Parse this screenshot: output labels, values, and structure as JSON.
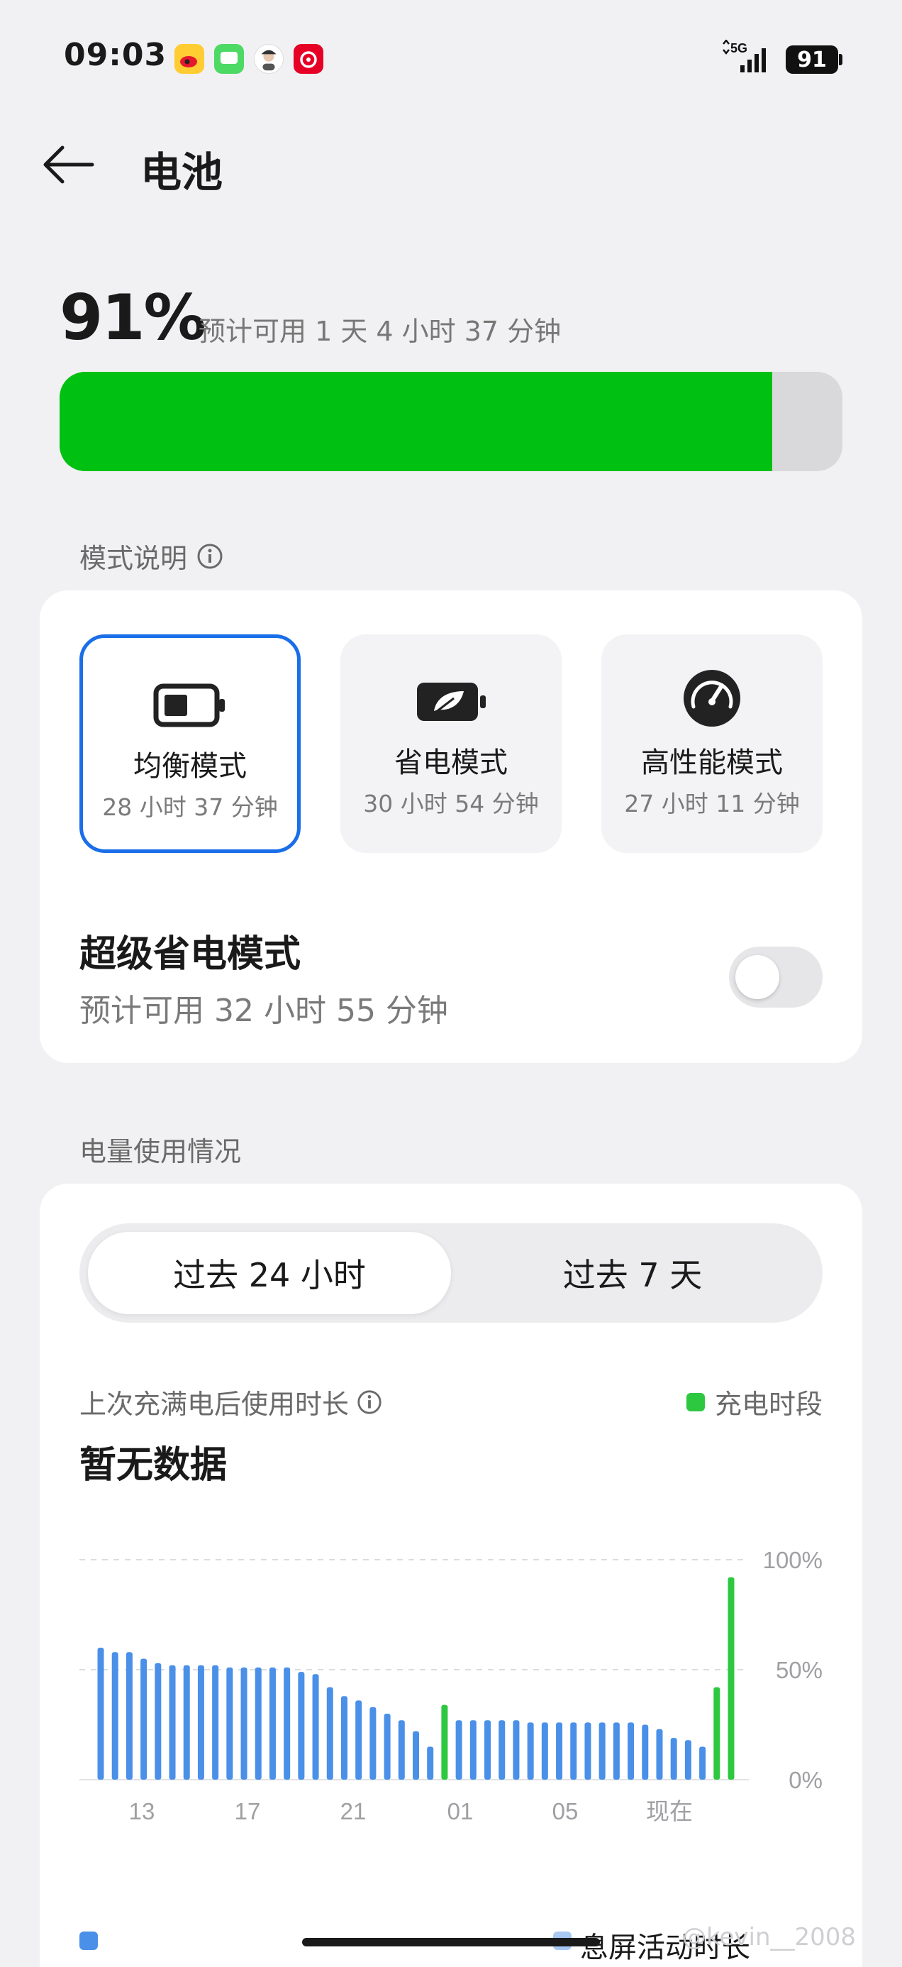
{
  "status_bar": {
    "time": "09:03",
    "network": "5G",
    "battery_level": "91",
    "app_icons": [
      "weibo-icon",
      "messages-icon",
      "avatar-icon",
      "netease-music-icon"
    ]
  },
  "header": {
    "title": "电池",
    "back_icon": "arrow-left-icon"
  },
  "battery": {
    "percent_label": "91%",
    "level_fraction": 0.91,
    "estimate": "预计可用 1 天 4 小时 37 分钟",
    "bar_color": "#00c112"
  },
  "mode_section": {
    "title": "模式说明",
    "info_icon": "info-icon",
    "modes": [
      {
        "name": "均衡模式",
        "time": "28 小时 37 分钟",
        "icon": "battery-icon",
        "selected": true
      },
      {
        "name": "省电模式",
        "time": "30 小时 54 分钟",
        "icon": "leaf-battery-icon",
        "selected": false
      },
      {
        "name": "高性能模式",
        "time": "27 小时 11 分钟",
        "icon": "speedometer-icon",
        "selected": false
      }
    ],
    "selected_color": "#1a6ee8"
  },
  "super_saver": {
    "title": "超级省电模式",
    "subtitle": "预计可用 32 小时 55 分钟",
    "enabled": false
  },
  "usage_section": {
    "title": "电量使用情况",
    "tabs": [
      "过去 24 小时",
      "过去 7 天"
    ],
    "active_tab": 0,
    "since_full_label": "上次充满电后使用时长",
    "charge_legend": "充电时段",
    "no_data": "暂无数据",
    "legend_screen_off": "息屏活动时长"
  },
  "chart_data": {
    "type": "bar",
    "y_ticks": [
      "100%",
      "50%",
      "0%"
    ],
    "ylim": [
      0,
      100
    ],
    "x_ticks": [
      "13",
      "17",
      "21",
      "01",
      "05",
      "现在"
    ],
    "colors": {
      "usage": "#4a90e8",
      "charging": "#2ec840"
    },
    "bars": [
      {
        "v": 60,
        "c": 0
      },
      {
        "v": 58,
        "c": 0
      },
      {
        "v": 58,
        "c": 0
      },
      {
        "v": 55,
        "c": 0
      },
      {
        "v": 53,
        "c": 0
      },
      {
        "v": 52,
        "c": 0
      },
      {
        "v": 52,
        "c": 0
      },
      {
        "v": 52,
        "c": 0
      },
      {
        "v": 52,
        "c": 0
      },
      {
        "v": 51,
        "c": 0
      },
      {
        "v": 51,
        "c": 0
      },
      {
        "v": 51,
        "c": 0
      },
      {
        "v": 51,
        "c": 0
      },
      {
        "v": 51,
        "c": 0
      },
      {
        "v": 49,
        "c": 0
      },
      {
        "v": 48,
        "c": 0
      },
      {
        "v": 42,
        "c": 0
      },
      {
        "v": 38,
        "c": 0
      },
      {
        "v": 36,
        "c": 0
      },
      {
        "v": 33,
        "c": 0
      },
      {
        "v": 30,
        "c": 0
      },
      {
        "v": 27,
        "c": 0
      },
      {
        "v": 22,
        "c": 0
      },
      {
        "v": 15,
        "c": 0
      },
      {
        "v": 34,
        "c": 1
      },
      {
        "v": 27,
        "c": 0
      },
      {
        "v": 27,
        "c": 0
      },
      {
        "v": 27,
        "c": 0
      },
      {
        "v": 27,
        "c": 0
      },
      {
        "v": 27,
        "c": 0
      },
      {
        "v": 26,
        "c": 0
      },
      {
        "v": 26,
        "c": 0
      },
      {
        "v": 26,
        "c": 0
      },
      {
        "v": 26,
        "c": 0
      },
      {
        "v": 26,
        "c": 0
      },
      {
        "v": 26,
        "c": 0
      },
      {
        "v": 26,
        "c": 0
      },
      {
        "v": 26,
        "c": 0
      },
      {
        "v": 25,
        "c": 0
      },
      {
        "v": 23,
        "c": 0
      },
      {
        "v": 19,
        "c": 0
      },
      {
        "v": 18,
        "c": 0
      },
      {
        "v": 15,
        "c": 0
      },
      {
        "v": 42,
        "c": 1
      },
      {
        "v": 92,
        "c": 1
      }
    ]
  }
}
